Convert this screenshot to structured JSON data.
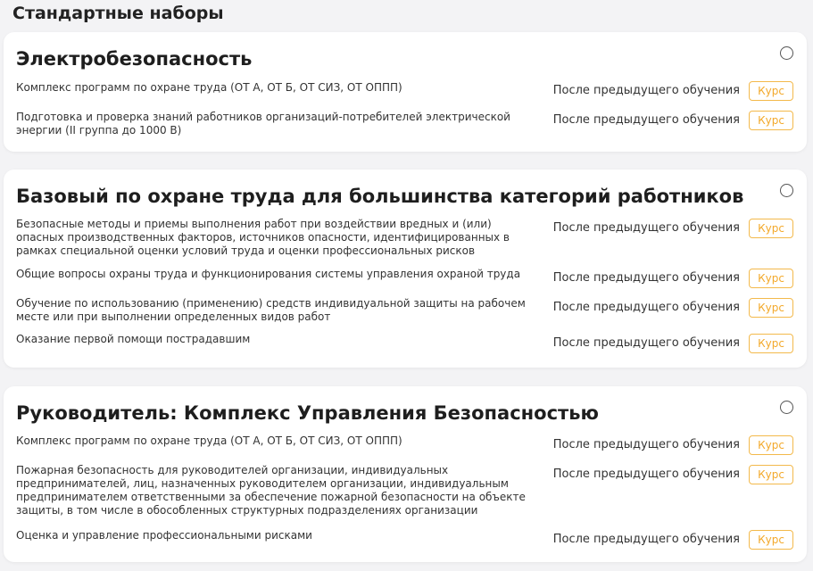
{
  "page": {
    "title": "Стандартные наборы"
  },
  "labels": {
    "after_previous": "После предыдущего обучения",
    "course_button": "Курс"
  },
  "sets": [
    {
      "title": "Электробезопасность",
      "selected": false,
      "courses": [
        {
          "name": "Комплекс программ по охране труда (ОТ А, ОТ Б, ОТ СИЗ, ОТ ОППП)"
        },
        {
          "name": "Подготовка и проверка знаний работников организаций-потребителей электрической энергии (II группа до 1000 В)"
        }
      ]
    },
    {
      "title": "Базовый по охране труда для большинства категорий работников",
      "selected": false,
      "courses": [
        {
          "name": "Безопасные методы и приемы выполнения работ при воздействии вредных и (или) опасных производственных факторов, источников опасности, идентифицированных в рамках специальной оценки условий труда и оценки профессиональных рисков"
        },
        {
          "name": "Общие вопросы охраны труда и функционирования системы управления охраной труда"
        },
        {
          "name": "Обучение по использованию (применению) средств индивидуальной защиты на рабочем месте или при выполнении определенных видов работ"
        },
        {
          "name": "Оказание первой помощи пострадавшим"
        }
      ]
    },
    {
      "title": "Руководитель: Комплекс Управления Безопасностью",
      "selected": false,
      "courses": [
        {
          "name": "Комплекс программ по охране труда (ОТ А, ОТ Б, ОТ СИЗ, ОТ ОППП)"
        },
        {
          "name": "Пожарная безопасность для руководителей организации, индивидуальных предпринимателей, лиц, назначенных руководителем организации, индивидуальным предпринимателем ответственными за обеспечение пожарной безопасности на объекте защиты, в том числе в обособленных структурных подразделениях организации"
        },
        {
          "name": "Оценка и управление профессиональными рисками"
        }
      ]
    }
  ]
}
